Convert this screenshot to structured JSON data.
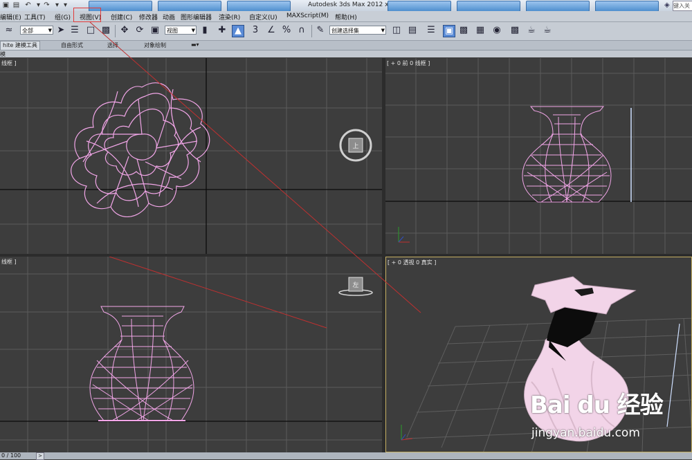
{
  "titlebar": {
    "app_title": "Autodesk 3ds Max 2012 x64",
    "search_placeholder": "键入关"
  },
  "menubar": {
    "items": [
      {
        "label": "编辑(E)"
      },
      {
        "label": "工具(T)"
      },
      {
        "label": "组(G)"
      },
      {
        "label": "视图(V)"
      },
      {
        "label": "创建(C)"
      },
      {
        "label": "修改器"
      },
      {
        "label": "动画"
      },
      {
        "label": "图形编辑器"
      },
      {
        "label": "渲染(R)"
      },
      {
        "label": "自定义(U)"
      },
      {
        "label": "MAXScript(M)"
      },
      {
        "label": "帮助(H)"
      }
    ],
    "highlight_color": "#e23a3a"
  },
  "toolbar": {
    "selection_filter": "全部",
    "reference_coord": "视图",
    "named_selection": "创建选择集",
    "snap_label": "3",
    "percent_snap": "%"
  },
  "ribbon": {
    "tabs": [
      {
        "label": "hite 建模工具"
      },
      {
        "label": "自由形式"
      },
      {
        "label": "选择"
      },
      {
        "label": "对象绘制"
      }
    ],
    "sub_label": "模"
  },
  "viewports": {
    "top": {
      "label": "线框 ]",
      "viewcube_face": "上"
    },
    "front": {
      "label": "[ + 0 前 0 线框 ]"
    },
    "left": {
      "label": "线框 ]",
      "viewcube_face": "左"
    },
    "perspective": {
      "label": "[ + 0 透视 0 真实 ]",
      "active_border_color": "#c7b163"
    }
  },
  "colors": {
    "viewport_bg": "#3d3d3d",
    "wireframe": "#f2a6e8",
    "shaded_vase": "#f2d4e8",
    "grid": "#5c5c5c",
    "axis": "#0b0b0b",
    "annotation_line": "#c03030"
  },
  "statusbar": {
    "frame_counter": "0 / 100",
    "time_arrow": ">"
  },
  "watermark": {
    "logo": "Bai du 经验",
    "url": "jingyan.baidu.com"
  }
}
